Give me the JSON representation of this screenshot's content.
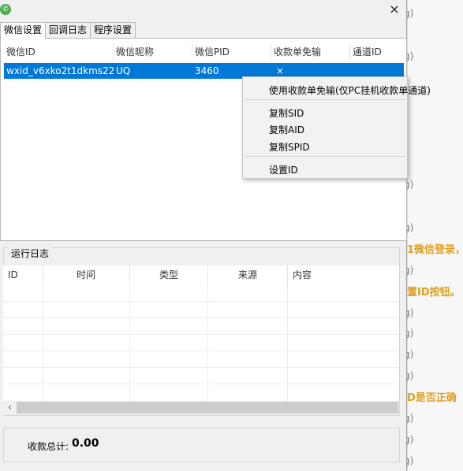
{
  "window": {
    "app_icon": "wechat-icon",
    "close_label": "×",
    "tabs": [
      {
        "label": "微信设置",
        "active": true
      },
      {
        "label": "回调日志",
        "active": false
      },
      {
        "label": "程序设置",
        "active": false
      }
    ]
  },
  "accounts_table": {
    "columns": [
      "微信ID",
      "微信昵称",
      "微信PID",
      "收款单免输",
      "通道ID"
    ],
    "rows": [
      {
        "wxid": "wxid_v6xko2t1dkms22",
        "nickname": "UQ",
        "pid": "3460",
        "receipt_free": "×",
        "channel_id": ""
      }
    ],
    "selected_row_color": "#0078d7"
  },
  "context_menu": {
    "items": [
      "使用收款单免输(仅PC挂机收款单通道)",
      "复制SID",
      "复制AID",
      "复制SPID",
      "设置ID"
    ]
  },
  "run_log": {
    "title": "运行日志",
    "columns": [
      "ID",
      "时间",
      "类型",
      "来源",
      "内容"
    ],
    "rows": []
  },
  "total": {
    "label": "收款总计:",
    "value": "0.00"
  },
  "background_window": {
    "text_color": "#e0a020",
    "marks": [
      "g)",
      "g)",
      "g)",
      "g)",
      "g)",
      "g)",
      "g)",
      "g)",
      "g)",
      "g)",
      "g)",
      "g)",
      "g)",
      "g)"
    ],
    "lines": [
      "1微信登录，",
      "置ID按钮。",
      "D是否正确"
    ]
  }
}
